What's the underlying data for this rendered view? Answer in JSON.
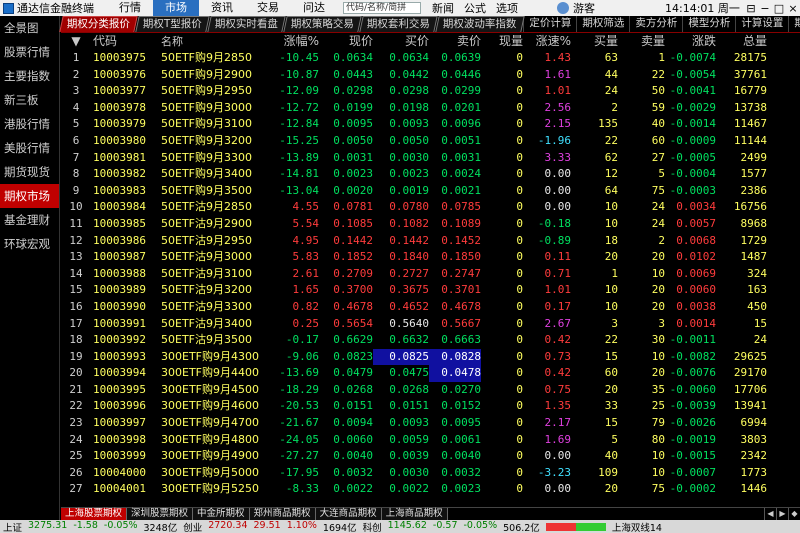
{
  "window": {
    "title": "通达信金融终端",
    "menus": [
      {
        "label": "行情",
        "active": false
      },
      {
        "label": "市场",
        "active": true
      },
      {
        "label": "资讯",
        "active": false
      },
      {
        "label": "交易",
        "active": false
      },
      {
        "label": "问达",
        "active": false
      }
    ],
    "search_placeholder": "代码/名称/简拼",
    "quick_items": [
      "新闻",
      "公式",
      "选项"
    ],
    "user": "游客",
    "clock": "14:14:01 周一",
    "controls": [
      "⊟",
      "−",
      "□",
      "×"
    ]
  },
  "sidebar": {
    "items": [
      {
        "label": "全景图",
        "active": false
      },
      {
        "label": "股票行情",
        "active": false
      },
      {
        "label": "主要指数",
        "active": false
      },
      {
        "label": "新三板",
        "active": false
      },
      {
        "label": "港股行情",
        "active": false
      },
      {
        "label": "美股行情",
        "active": false
      },
      {
        "label": "期货现货",
        "active": false
      },
      {
        "label": "期权市场",
        "active": true
      },
      {
        "label": "基金理财",
        "active": false
      },
      {
        "label": "环球宏观",
        "active": false
      }
    ]
  },
  "tabs": {
    "left": [
      {
        "label": "期权分类报价",
        "active": true
      },
      {
        "label": "期权T型报价",
        "active": false
      },
      {
        "label": "期权实时看盘",
        "active": false
      },
      {
        "label": "期权策略交易",
        "active": false
      },
      {
        "label": "期权套利交易",
        "active": false
      },
      {
        "label": "期权波动率指数",
        "active": false
      }
    ],
    "right": [
      "定价计算",
      "期权筛选",
      "卖方分析",
      "模型分析",
      "计算设置",
      "期权"
    ]
  },
  "table": {
    "headers": {
      "idx": "",
      "code": "代码",
      "name": "名称",
      "chg": "涨幅%",
      "last": "现价",
      "bid": "买价",
      "ask": "卖价",
      "vol": "现量",
      "spd": "涨速%",
      "bidv": "买量",
      "askv": "卖量",
      "delta": "涨跌",
      "total": "总量"
    },
    "rows": [
      {
        "idx": "1",
        "code": "10003975",
        "name": "50ETF购9月2850",
        "chg": "-10.45",
        "last": "0.0634",
        "bid": "0.0634",
        "ask": "0.0639",
        "vol": "0",
        "spd": "1.43",
        "bidv": "63",
        "askv": "1",
        "delta": "-0.0074",
        "total": "28175",
        "dir": "down",
        "spd_cls": "up"
      },
      {
        "idx": "2",
        "code": "10003976",
        "name": "50ETF购9月2900",
        "chg": "-10.87",
        "last": "0.0443",
        "bid": "0.0442",
        "ask": "0.0446",
        "vol": "0",
        "spd": "1.61",
        "bidv": "44",
        "askv": "22",
        "delta": "-0.0054",
        "total": "37761",
        "dir": "down",
        "spd_cls": "mag"
      },
      {
        "idx": "3",
        "code": "10003977",
        "name": "50ETF购9月2950",
        "chg": "-12.09",
        "last": "0.0298",
        "bid": "0.0298",
        "ask": "0.0299",
        "vol": "0",
        "spd": "1.01",
        "bidv": "24",
        "askv": "50",
        "delta": "-0.0041",
        "total": "16779",
        "dir": "down",
        "spd_cls": "up"
      },
      {
        "idx": "4",
        "code": "10003978",
        "name": "50ETF购9月3000",
        "chg": "-12.72",
        "last": "0.0199",
        "bid": "0.0198",
        "ask": "0.0201",
        "vol": "0",
        "spd": "2.56",
        "bidv": "2",
        "askv": "59",
        "delta": "-0.0029",
        "total": "13738",
        "dir": "down",
        "spd_cls": "mag"
      },
      {
        "idx": "5",
        "code": "10003979",
        "name": "50ETF购9月3100",
        "chg": "-12.84",
        "last": "0.0095",
        "bid": "0.0093",
        "ask": "0.0096",
        "vol": "0",
        "spd": "2.15",
        "bidv": "135",
        "askv": "40",
        "delta": "-0.0014",
        "total": "11467",
        "dir": "down",
        "spd_cls": "mag"
      },
      {
        "idx": "6",
        "code": "10003980",
        "name": "50ETF购9月3200",
        "chg": "-15.25",
        "last": "0.0050",
        "bid": "0.0050",
        "ask": "0.0051",
        "vol": "0",
        "spd": "-1.96",
        "bidv": "22",
        "askv": "60",
        "delta": "-0.0009",
        "total": "11144",
        "dir": "down",
        "spd_cls": "cyan"
      },
      {
        "idx": "7",
        "code": "10003981",
        "name": "50ETF购9月3300",
        "chg": "-13.89",
        "last": "0.0031",
        "bid": "0.0030",
        "ask": "0.0031",
        "vol": "0",
        "spd": "3.33",
        "bidv": "62",
        "askv": "27",
        "delta": "-0.0005",
        "total": "2499",
        "dir": "down",
        "spd_cls": "mag"
      },
      {
        "idx": "8",
        "code": "10003982",
        "name": "50ETF购9月3400",
        "chg": "-14.81",
        "last": "0.0023",
        "bid": "0.0023",
        "ask": "0.0024",
        "vol": "0",
        "spd": "0.00",
        "bidv": "12",
        "askv": "5",
        "delta": "-0.0004",
        "total": "1577",
        "dir": "down",
        "spd_cls": "flat"
      },
      {
        "idx": "9",
        "code": "10003983",
        "name": "50ETF购9月3500",
        "chg": "-13.04",
        "last": "0.0020",
        "bid": "0.0019",
        "ask": "0.0021",
        "vol": "0",
        "spd": "0.00",
        "bidv": "64",
        "askv": "75",
        "delta": "-0.0003",
        "total": "2386",
        "dir": "down",
        "spd_cls": "flat"
      },
      {
        "idx": "10",
        "code": "10003984",
        "name": "50ETF沽9月2850",
        "chg": "4.55",
        "last": "0.0781",
        "bid": "0.0780",
        "ask": "0.0785",
        "vol": "0",
        "spd": "0.00",
        "bidv": "10",
        "askv": "24",
        "delta": "0.0034",
        "total": "16756",
        "dir": "up",
        "spd_cls": "flat"
      },
      {
        "idx": "11",
        "code": "10003985",
        "name": "50ETF沽9月2900",
        "chg": "5.54",
        "last": "0.1085",
        "bid": "0.1082",
        "ask": "0.1089",
        "vol": "0",
        "spd": "-0.18",
        "bidv": "10",
        "askv": "24",
        "delta": "0.0057",
        "total": "8968",
        "dir": "up",
        "spd_cls": "down"
      },
      {
        "idx": "12",
        "code": "10003986",
        "name": "50ETF沽9月2950",
        "chg": "4.95",
        "last": "0.1442",
        "bid": "0.1442",
        "ask": "0.1452",
        "vol": "0",
        "spd": "-0.89",
        "bidv": "18",
        "askv": "2",
        "delta": "0.0068",
        "total": "1729",
        "dir": "up",
        "spd_cls": "down"
      },
      {
        "idx": "13",
        "code": "10003987",
        "name": "50ETF沽9月3000",
        "chg": "5.83",
        "last": "0.1852",
        "bid": "0.1840",
        "ask": "0.1850",
        "vol": "0",
        "spd": "0.11",
        "bidv": "20",
        "askv": "20",
        "delta": "0.0102",
        "total": "1487",
        "dir": "up",
        "spd_cls": "up"
      },
      {
        "idx": "14",
        "code": "10003988",
        "name": "50ETF沽9月3100",
        "chg": "2.61",
        "last": "0.2709",
        "bid": "0.2727",
        "ask": "0.2747",
        "vol": "0",
        "spd": "0.71",
        "bidv": "1",
        "askv": "10",
        "delta": "0.0069",
        "total": "324",
        "dir": "up",
        "spd_cls": "up"
      },
      {
        "idx": "15",
        "code": "10003989",
        "name": "50ETF沽9月3200",
        "chg": "1.65",
        "last": "0.3700",
        "bid": "0.3675",
        "ask": "0.3701",
        "vol": "0",
        "spd": "1.01",
        "bidv": "10",
        "askv": "20",
        "delta": "0.0060",
        "total": "163",
        "dir": "up",
        "spd_cls": "up"
      },
      {
        "idx": "16",
        "code": "10003990",
        "name": "50ETF沽9月3300",
        "chg": "0.82",
        "last": "0.4678",
        "bid": "0.4652",
        "ask": "0.4678",
        "vol": "0",
        "spd": "0.17",
        "bidv": "10",
        "askv": "20",
        "delta": "0.0038",
        "total": "450",
        "dir": "up",
        "spd_cls": "up"
      },
      {
        "idx": "17",
        "code": "10003991",
        "name": "50ETF沽9月3400",
        "chg": "0.25",
        "last": "0.5654",
        "bid": "0.5640",
        "ask": "0.5667",
        "vol": "0",
        "spd": "2.67",
        "bidv": "3",
        "askv": "3",
        "delta": "0.0014",
        "total": "15",
        "dir": "up",
        "spd_cls": "mag",
        "bid_cls": "flat"
      },
      {
        "idx": "18",
        "code": "10003992",
        "name": "50ETF沽9月3500",
        "chg": "-0.17",
        "last": "0.6629",
        "bid": "0.6632",
        "ask": "0.6663",
        "vol": "0",
        "spd": "0.42",
        "bidv": "22",
        "askv": "30",
        "delta": "-0.0011",
        "total": "24",
        "dir": "down",
        "spd_cls": "up"
      },
      {
        "idx": "19",
        "code": "10003993",
        "name": "300ETF购9月4300",
        "chg": "-9.06",
        "last": "0.0823",
        "bid": "0.0825",
        "ask": "0.0828",
        "vol": "0",
        "spd": "0.73",
        "bidv": "15",
        "askv": "10",
        "delta": "-0.0082",
        "total": "29625",
        "dir": "down",
        "spd_cls": "up",
        "hl_bid": true,
        "hl_ask": true
      },
      {
        "idx": "20",
        "code": "10003994",
        "name": "300ETF购9月4400",
        "chg": "-13.69",
        "last": "0.0479",
        "bid": "0.0475",
        "ask": "0.0478",
        "vol": "0",
        "spd": "0.42",
        "bidv": "60",
        "askv": "20",
        "delta": "-0.0076",
        "total": "29170",
        "dir": "down",
        "spd_cls": "up",
        "hl_ask": true
      },
      {
        "idx": "21",
        "code": "10003995",
        "name": "300ETF购9月4500",
        "chg": "-18.29",
        "last": "0.0268",
        "bid": "0.0268",
        "ask": "0.0270",
        "vol": "0",
        "spd": "0.75",
        "bidv": "20",
        "askv": "35",
        "delta": "-0.0060",
        "total": "17706",
        "dir": "down",
        "spd_cls": "up"
      },
      {
        "idx": "22",
        "code": "10003996",
        "name": "300ETF购9月4600",
        "chg": "-20.53",
        "last": "0.0151",
        "bid": "0.0151",
        "ask": "0.0152",
        "vol": "0",
        "spd": "1.35",
        "bidv": "33",
        "askv": "25",
        "delta": "-0.0039",
        "total": "13941",
        "dir": "down",
        "spd_cls": "up"
      },
      {
        "idx": "23",
        "code": "10003997",
        "name": "300ETF购9月4700",
        "chg": "-21.67",
        "last": "0.0094",
        "bid": "0.0093",
        "ask": "0.0095",
        "vol": "0",
        "spd": "2.17",
        "bidv": "15",
        "askv": "79",
        "delta": "-0.0026",
        "total": "6994",
        "dir": "down",
        "spd_cls": "mag"
      },
      {
        "idx": "24",
        "code": "10003998",
        "name": "300ETF购9月4800",
        "chg": "-24.05",
        "last": "0.0060",
        "bid": "0.0059",
        "ask": "0.0061",
        "vol": "0",
        "spd": "1.69",
        "bidv": "5",
        "askv": "80",
        "delta": "-0.0019",
        "total": "3803",
        "dir": "down",
        "spd_cls": "mag"
      },
      {
        "idx": "25",
        "code": "10003999",
        "name": "300ETF购9月4900",
        "chg": "-27.27",
        "last": "0.0040",
        "bid": "0.0039",
        "ask": "0.0040",
        "vol": "0",
        "spd": "0.00",
        "bidv": "40",
        "askv": "10",
        "delta": "-0.0015",
        "total": "2342",
        "dir": "down",
        "spd_cls": "flat"
      },
      {
        "idx": "26",
        "code": "10004000",
        "name": "300ETF购9月5000",
        "chg": "-17.95",
        "last": "0.0032",
        "bid": "0.0030",
        "ask": "0.0032",
        "vol": "0",
        "spd": "-3.23",
        "bidv": "109",
        "askv": "10",
        "delta": "-0.0007",
        "total": "1773",
        "dir": "down",
        "spd_cls": "cyan"
      },
      {
        "idx": "27",
        "code": "10004001",
        "name": "300ETF购9月5250",
        "chg": "-8.33",
        "last": "0.0022",
        "bid": "0.0022",
        "ask": "0.0023",
        "vol": "0",
        "spd": "0.00",
        "bidv": "20",
        "askv": "75",
        "delta": "-0.0002",
        "total": "1446",
        "dir": "down",
        "spd_cls": "flat"
      }
    ]
  },
  "bottom_tabs": [
    {
      "label": "上海股票期权",
      "active": true
    },
    {
      "label": "深圳股票期权",
      "active": false
    },
    {
      "label": "中金所期权",
      "active": false
    },
    {
      "label": "郑州商品期权",
      "active": false
    },
    {
      "label": "大连商品期权",
      "active": false
    },
    {
      "label": "上海商品期权",
      "active": false
    }
  ],
  "statusbar": {
    "items": [
      {
        "text": "上证",
        "cls": ""
      },
      {
        "text": "3275.31",
        "cls": "g"
      },
      {
        "text": "-1.58",
        "cls": "g"
      },
      {
        "text": "-0.05%",
        "cls": "g"
      },
      {
        "text": "3248亿",
        "cls": ""
      },
      {
        "text": "创业",
        "cls": ""
      },
      {
        "text": "2720.34",
        "cls": "r"
      },
      {
        "text": "29.51",
        "cls": "r"
      },
      {
        "text": "1.10%",
        "cls": "r"
      },
      {
        "text": "1694亿",
        "cls": ""
      },
      {
        "text": "科创",
        "cls": ""
      },
      {
        "text": "1145.62",
        "cls": "g"
      },
      {
        "text": "-0.57",
        "cls": "g"
      },
      {
        "text": "-0.05%",
        "cls": "g"
      },
      {
        "text": "506.2亿",
        "cls": ""
      }
    ],
    "feed": "上海双线14"
  }
}
